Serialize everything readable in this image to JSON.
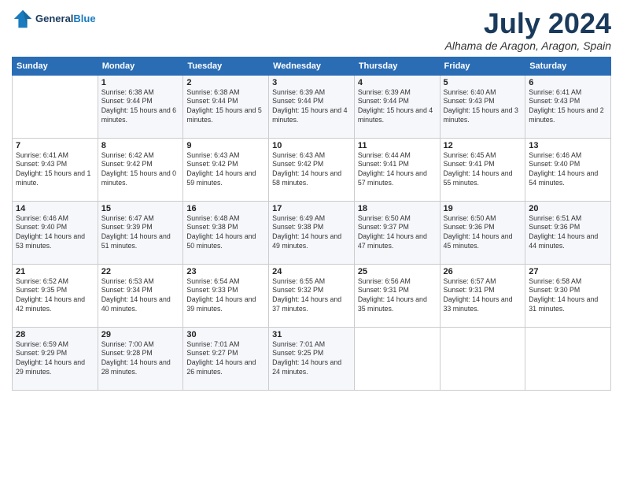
{
  "logo": {
    "line1": "General",
    "line2": "Blue"
  },
  "header": {
    "month": "July 2024",
    "location": "Alhama de Aragon, Aragon, Spain"
  },
  "weekdays": [
    "Sunday",
    "Monday",
    "Tuesday",
    "Wednesday",
    "Thursday",
    "Friday",
    "Saturday"
  ],
  "weeks": [
    [
      {
        "day": "",
        "sunrise": "",
        "sunset": "",
        "daylight": ""
      },
      {
        "day": "1",
        "sunrise": "Sunrise: 6:38 AM",
        "sunset": "Sunset: 9:44 PM",
        "daylight": "Daylight: 15 hours and 6 minutes."
      },
      {
        "day": "2",
        "sunrise": "Sunrise: 6:38 AM",
        "sunset": "Sunset: 9:44 PM",
        "daylight": "Daylight: 15 hours and 5 minutes."
      },
      {
        "day": "3",
        "sunrise": "Sunrise: 6:39 AM",
        "sunset": "Sunset: 9:44 PM",
        "daylight": "Daylight: 15 hours and 4 minutes."
      },
      {
        "day": "4",
        "sunrise": "Sunrise: 6:39 AM",
        "sunset": "Sunset: 9:44 PM",
        "daylight": "Daylight: 15 hours and 4 minutes."
      },
      {
        "day": "5",
        "sunrise": "Sunrise: 6:40 AM",
        "sunset": "Sunset: 9:43 PM",
        "daylight": "Daylight: 15 hours and 3 minutes."
      },
      {
        "day": "6",
        "sunrise": "Sunrise: 6:41 AM",
        "sunset": "Sunset: 9:43 PM",
        "daylight": "Daylight: 15 hours and 2 minutes."
      }
    ],
    [
      {
        "day": "7",
        "sunrise": "Sunrise: 6:41 AM",
        "sunset": "Sunset: 9:43 PM",
        "daylight": "Daylight: 15 hours and 1 minute."
      },
      {
        "day": "8",
        "sunrise": "Sunrise: 6:42 AM",
        "sunset": "Sunset: 9:42 PM",
        "daylight": "Daylight: 15 hours and 0 minutes."
      },
      {
        "day": "9",
        "sunrise": "Sunrise: 6:43 AM",
        "sunset": "Sunset: 9:42 PM",
        "daylight": "Daylight: 14 hours and 59 minutes."
      },
      {
        "day": "10",
        "sunrise": "Sunrise: 6:43 AM",
        "sunset": "Sunset: 9:42 PM",
        "daylight": "Daylight: 14 hours and 58 minutes."
      },
      {
        "day": "11",
        "sunrise": "Sunrise: 6:44 AM",
        "sunset": "Sunset: 9:41 PM",
        "daylight": "Daylight: 14 hours and 57 minutes."
      },
      {
        "day": "12",
        "sunrise": "Sunrise: 6:45 AM",
        "sunset": "Sunset: 9:41 PM",
        "daylight": "Daylight: 14 hours and 55 minutes."
      },
      {
        "day": "13",
        "sunrise": "Sunrise: 6:46 AM",
        "sunset": "Sunset: 9:40 PM",
        "daylight": "Daylight: 14 hours and 54 minutes."
      }
    ],
    [
      {
        "day": "14",
        "sunrise": "Sunrise: 6:46 AM",
        "sunset": "Sunset: 9:40 PM",
        "daylight": "Daylight: 14 hours and 53 minutes."
      },
      {
        "day": "15",
        "sunrise": "Sunrise: 6:47 AM",
        "sunset": "Sunset: 9:39 PM",
        "daylight": "Daylight: 14 hours and 51 minutes."
      },
      {
        "day": "16",
        "sunrise": "Sunrise: 6:48 AM",
        "sunset": "Sunset: 9:38 PM",
        "daylight": "Daylight: 14 hours and 50 minutes."
      },
      {
        "day": "17",
        "sunrise": "Sunrise: 6:49 AM",
        "sunset": "Sunset: 9:38 PM",
        "daylight": "Daylight: 14 hours and 49 minutes."
      },
      {
        "day": "18",
        "sunrise": "Sunrise: 6:50 AM",
        "sunset": "Sunset: 9:37 PM",
        "daylight": "Daylight: 14 hours and 47 minutes."
      },
      {
        "day": "19",
        "sunrise": "Sunrise: 6:50 AM",
        "sunset": "Sunset: 9:36 PM",
        "daylight": "Daylight: 14 hours and 45 minutes."
      },
      {
        "day": "20",
        "sunrise": "Sunrise: 6:51 AM",
        "sunset": "Sunset: 9:36 PM",
        "daylight": "Daylight: 14 hours and 44 minutes."
      }
    ],
    [
      {
        "day": "21",
        "sunrise": "Sunrise: 6:52 AM",
        "sunset": "Sunset: 9:35 PM",
        "daylight": "Daylight: 14 hours and 42 minutes."
      },
      {
        "day": "22",
        "sunrise": "Sunrise: 6:53 AM",
        "sunset": "Sunset: 9:34 PM",
        "daylight": "Daylight: 14 hours and 40 minutes."
      },
      {
        "day": "23",
        "sunrise": "Sunrise: 6:54 AM",
        "sunset": "Sunset: 9:33 PM",
        "daylight": "Daylight: 14 hours and 39 minutes."
      },
      {
        "day": "24",
        "sunrise": "Sunrise: 6:55 AM",
        "sunset": "Sunset: 9:32 PM",
        "daylight": "Daylight: 14 hours and 37 minutes."
      },
      {
        "day": "25",
        "sunrise": "Sunrise: 6:56 AM",
        "sunset": "Sunset: 9:31 PM",
        "daylight": "Daylight: 14 hours and 35 minutes."
      },
      {
        "day": "26",
        "sunrise": "Sunrise: 6:57 AM",
        "sunset": "Sunset: 9:31 PM",
        "daylight": "Daylight: 14 hours and 33 minutes."
      },
      {
        "day": "27",
        "sunrise": "Sunrise: 6:58 AM",
        "sunset": "Sunset: 9:30 PM",
        "daylight": "Daylight: 14 hours and 31 minutes."
      }
    ],
    [
      {
        "day": "28",
        "sunrise": "Sunrise: 6:59 AM",
        "sunset": "Sunset: 9:29 PM",
        "daylight": "Daylight: 14 hours and 29 minutes."
      },
      {
        "day": "29",
        "sunrise": "Sunrise: 7:00 AM",
        "sunset": "Sunset: 9:28 PM",
        "daylight": "Daylight: 14 hours and 28 minutes."
      },
      {
        "day": "30",
        "sunrise": "Sunrise: 7:01 AM",
        "sunset": "Sunset: 9:27 PM",
        "daylight": "Daylight: 14 hours and 26 minutes."
      },
      {
        "day": "31",
        "sunrise": "Sunrise: 7:01 AM",
        "sunset": "Sunset: 9:25 PM",
        "daylight": "Daylight: 14 hours and 24 minutes."
      },
      {
        "day": "",
        "sunrise": "",
        "sunset": "",
        "daylight": ""
      },
      {
        "day": "",
        "sunrise": "",
        "sunset": "",
        "daylight": ""
      },
      {
        "day": "",
        "sunrise": "",
        "sunset": "",
        "daylight": ""
      }
    ]
  ]
}
